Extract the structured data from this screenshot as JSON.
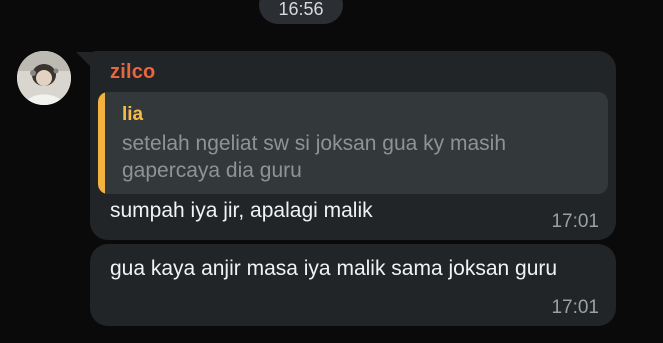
{
  "date_pill": {
    "text": "16:56"
  },
  "sender": {
    "name": "zilco",
    "name_color": "#e8673f",
    "avatar_icon": "profile-photo"
  },
  "messages": [
    {
      "reply": {
        "name": "lia",
        "text": "setelah ngeliat sw si joksan gua ky masih gapercaya dia guru",
        "bar_color": "#f4b23e"
      },
      "text": "sumpah iya jir, apalagi malik",
      "time": "17:01"
    },
    {
      "text": "gua kaya anjir masa iya malik sama joksan guru",
      "time": "17:01"
    }
  ],
  "colors": {
    "background": "#0a0a0a",
    "bubble": "#212527",
    "reply_bg": "#33383b"
  }
}
